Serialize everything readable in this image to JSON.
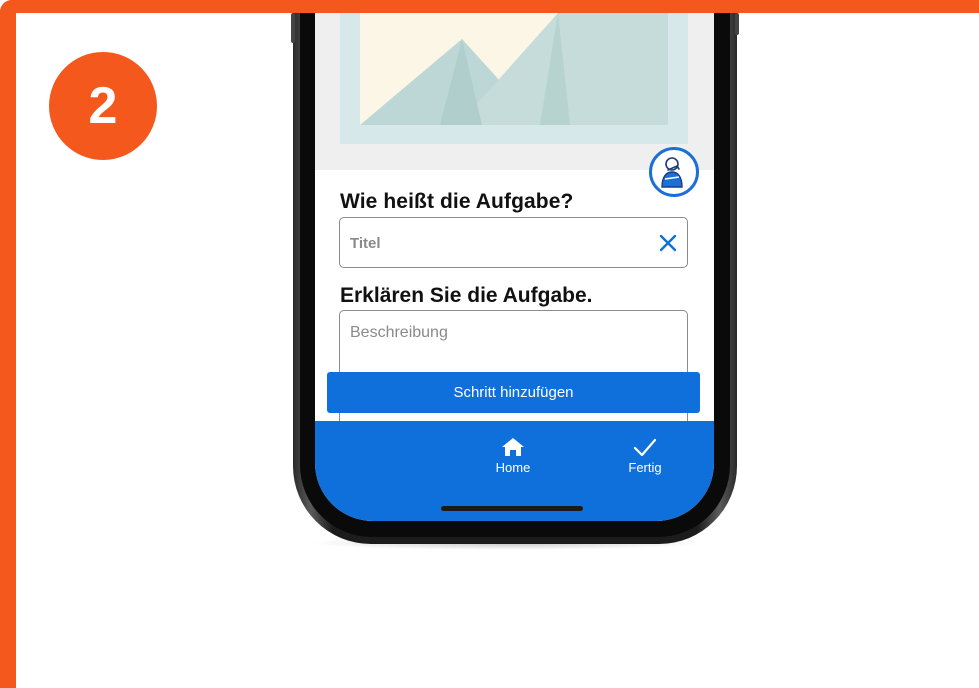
{
  "badge": {
    "step_number": "2"
  },
  "form": {
    "title_question": "Wie heißt die Aufgabe?",
    "title_placeholder": "Titel",
    "description_question": "Erklären Sie die Aufgabe.",
    "description_placeholder": "Beschreibung",
    "add_step_label": "Schritt hinzufügen"
  },
  "nav": {
    "home_label": "Home",
    "home_icon": "home-icon",
    "done_label": "Fertig",
    "done_icon": "checkmark-icon"
  },
  "colors": {
    "accent_orange": "#f4581c",
    "primary_blue": "#1070db",
    "placeholder_gray": "#8a8a8a"
  }
}
